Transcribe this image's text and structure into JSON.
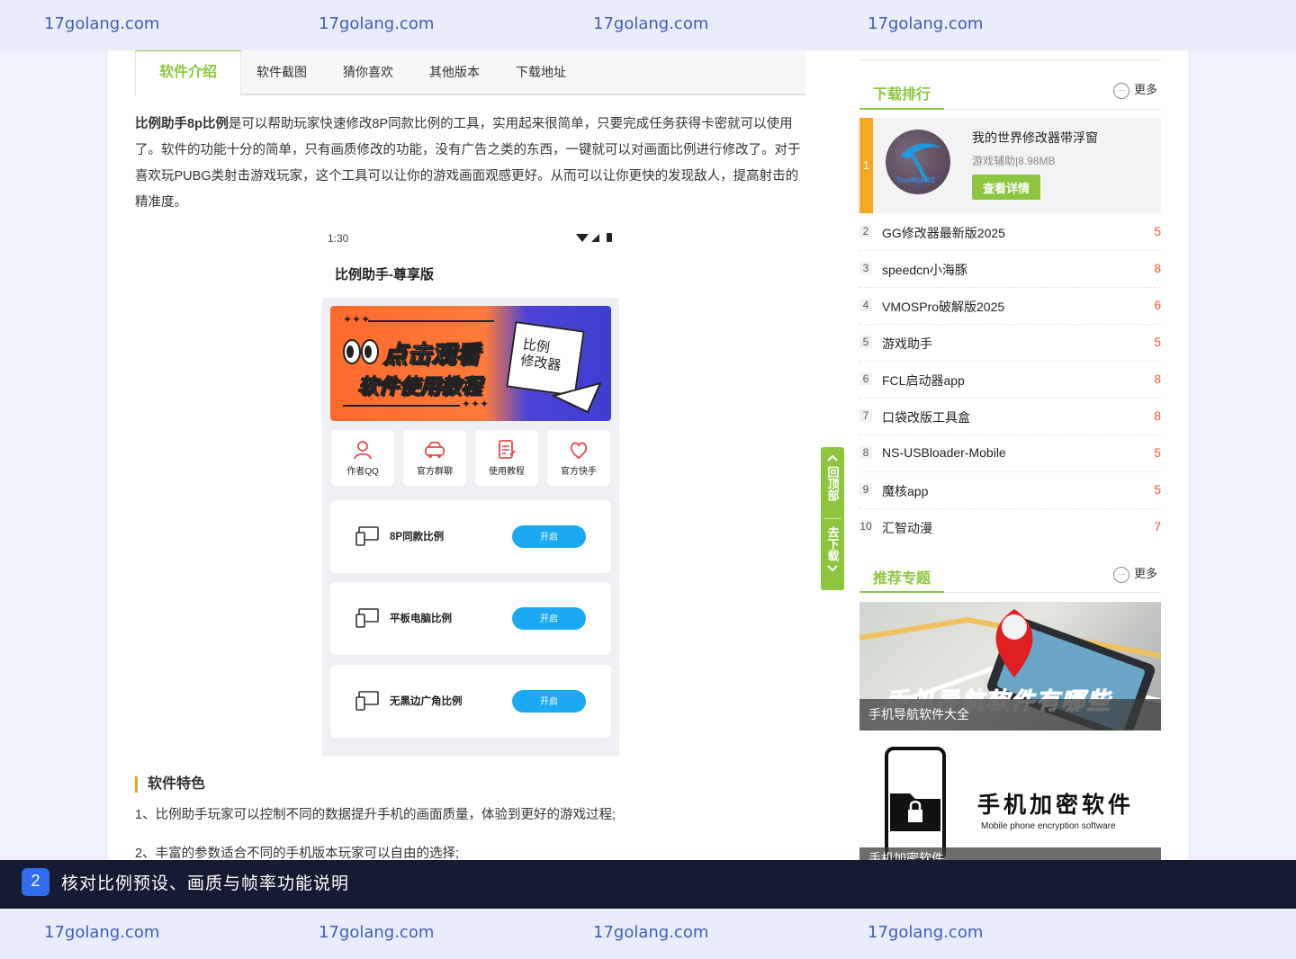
{
  "watermark": {
    "text": "17golang.com"
  },
  "tabs": [
    "软件介绍",
    "软件截图",
    "猜你喜欢",
    "其他版本",
    "下载地址"
  ],
  "intro": {
    "bold": "比例助手8p比例",
    "text": "是可以帮助玩家快速修改8P同款比例的工具，实用起来很简单，只要完成任务获得卡密就可以使用了。软件的功能十分的简单，只有画质修改的功能，没有广告之类的东西，一键就可以对画面比例进行修改了。对于喜欢玩PUBG类射击游戏玩家，这个工具可以让你的游戏画面观感更好。从而可以让你更快的发现敌人，提高射击的精准度。"
  },
  "phone": {
    "time": "1:30",
    "title": "比例助手-尊享版",
    "banner_line1": "点击观看",
    "banner_line2": "软件使用教程",
    "banner_card": "比例\n修改器",
    "quick_buttons": [
      "作者QQ",
      "官方群聊",
      "使用教程",
      "官方快手"
    ],
    "options": [
      {
        "label": "8P同款比例",
        "button": "开启"
      },
      {
        "label": "平板电脑比例",
        "button": "开启"
      },
      {
        "label": "无黑边广角比例",
        "button": "开启"
      }
    ]
  },
  "features": {
    "heading": "软件特色",
    "items": [
      "1、比例助手玩家可以控制不同的数据提升手机的画面质量，体验到更好的游戏过程;",
      "2、丰富的参数适合不同的手机版本玩家可以自由的选择;"
    ]
  },
  "float_nav": {
    "top": "回顶部",
    "download": "去下载"
  },
  "sidebar": {
    "rank_title": "下载排行",
    "more": "更多",
    "top1": {
      "rank": "1",
      "name": "我的世界修改器带浮窗",
      "meta": "游戏辅助|8.98MB",
      "button": "查看详情",
      "icon_text": "ToolMcFRZ"
    },
    "ranks": [
      {
        "n": "2",
        "name": "GG修改器最新版2025",
        "v": "5"
      },
      {
        "n": "3",
        "name": "speedcn小海豚",
        "v": "8"
      },
      {
        "n": "4",
        "name": "VMOSPro破解版2025",
        "v": "6"
      },
      {
        "n": "5",
        "name": "游戏助手",
        "v": "5"
      },
      {
        "n": "6",
        "name": "FCL启动器app",
        "v": "8"
      },
      {
        "n": "7",
        "name": "口袋改版工具盒",
        "v": "8"
      },
      {
        "n": "8",
        "name": "NS-USBloader-Mobile",
        "v": "5"
      },
      {
        "n": "9",
        "name": "魔核app",
        "v": "5"
      },
      {
        "n": "10",
        "name": "汇智动漫",
        "v": "7"
      }
    ],
    "topic_title": "推荐专题",
    "topics": [
      {
        "caption": "手机导航软件大全",
        "art_text": "手机导航软件有哪些"
      },
      {
        "caption": "手机加密软件",
        "art_text": "手机加密软件",
        "art_sub": "Mobile phone encryption software"
      }
    ]
  },
  "caption": {
    "number": "2",
    "text": "核对比例预设、画质与帧率功能说明"
  },
  "colors": {
    "accent": "#8cc63f",
    "rank_value": "#f4563a",
    "rank_bar": "#f5a623",
    "caption_bg": "#141b33",
    "badge": "#2f6cf0",
    "toggle": "#1aa9f2"
  }
}
